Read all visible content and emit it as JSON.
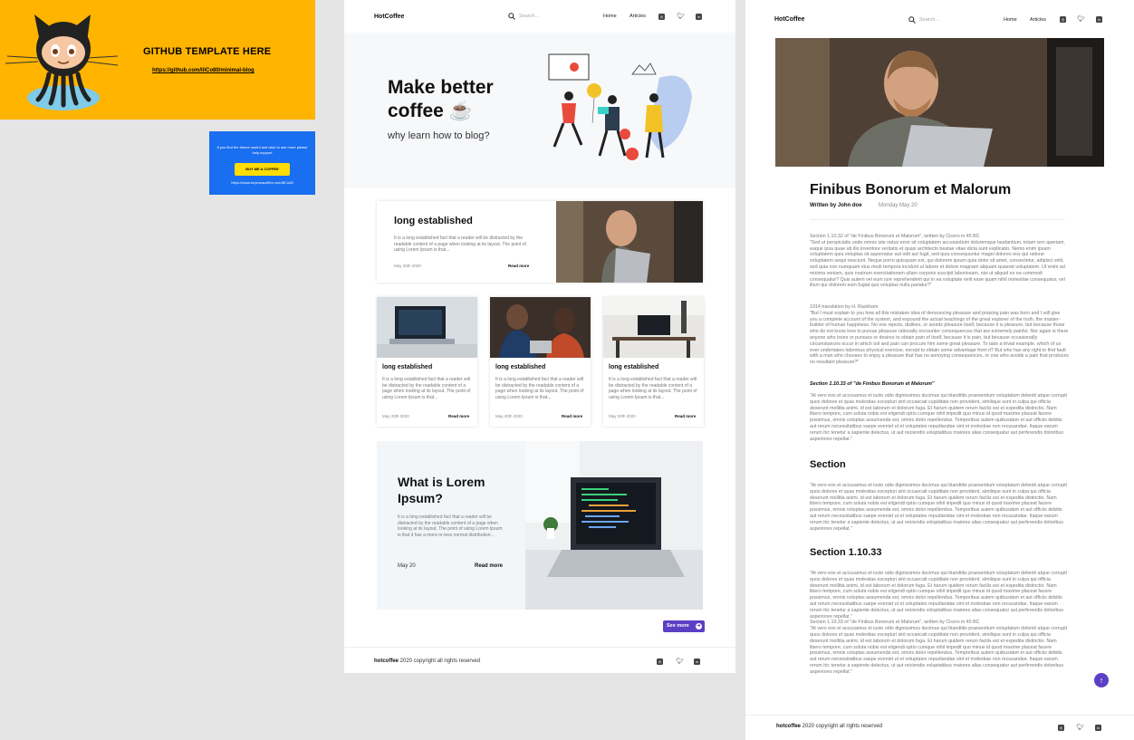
{
  "promo": {
    "github_title": "GITHUB TEMPLATE HERE",
    "github_link": "https://github.com/lilCo80/minimal-blog",
    "bmc_message": "If you find the theme useful and wish to see more please help support",
    "bmc_button": "BUY ME A COFFEE",
    "bmc_url": "https://www.buymeacoffee.com/lilCo80"
  },
  "nav": {
    "brand": "HotCoffee",
    "search_placeholder": "Search...",
    "home": "Home",
    "articles": "Articles"
  },
  "hero": {
    "title": "Make better coffee ☕",
    "subtitle": "why learn how to blog?"
  },
  "featured": {
    "title": "long established",
    "text": "It is a long established fact that a reader will be distracted by the readable content of a page when looking at its layout. The point of using Lorem Ipsum is that...",
    "date": "May 20th 2020",
    "more": "Read more"
  },
  "cards": [
    {
      "title": "long established",
      "text": "It is a long established fact that a reader will be distracted by the readable content of a page when looking at its layout. The point of using Lorem Ipsum is that...",
      "date": "May 20th 2020",
      "more": "Read more"
    },
    {
      "title": "long established",
      "text": "It is a long established fact that a reader will be distracted by the readable content of a page when looking at its layout. The point of using Lorem Ipsum is that...",
      "date": "May 20th 2020",
      "more": "Read more"
    },
    {
      "title": "long established",
      "text": "It is a long established fact that a reader will be distracted by the readable content of a page when looking at its layout. The point of using Lorem Ipsum is that...",
      "date": "May 20th 2020",
      "more": "Read more"
    }
  ],
  "big_card": {
    "title": "What is Lorem Ipsum?",
    "text": "It is a long established fact that a reader will be distracted by the readable content of a page when looking at its layout. The point of using Lorem Ipsum is that it has a more-or-less normal distribution...",
    "date": "May 20",
    "more": "Read more"
  },
  "see_more": "See more",
  "footer": {
    "brand": "hotcoffee",
    "text": " 2020 copyright all rights reserved"
  },
  "article": {
    "title": "Finibus Bonorum et Malorum",
    "author": "Written by John doe",
    "date": "Monday  May 20",
    "p1": "Section 1.10.32 of \"de Finibus Bonorum et Malorum\", written by Cicero in 45 BC\n\"Sed ut perspiciatis unde omnis iste natus error sit voluptatem accusantium doloremque laudantium, totam rem aperiam, eaque ipsa quae ab illo inventore veritatis et quasi architecto beatae vitae dicta sunt explicabo. Nemo enim ipsam voluptatem quia voluptas sit aspernatur aut odit aut fugit, sed quia consequuntur magni dolores eos qui ratione voluptatem sequi nesciunt. Neque porro quisquam est, qui dolorem ipsum quia dolor sit amet, consectetur, adipisci velit, sed quia non numquam eius modi tempora incidunt ut labore et dolore magnam aliquam quaerat voluptatem. Ut enim ad minima veniam, quis nostrum exercitationem ullam corporis suscipit laboriosam, nisi ut aliquid ex ea commodi consequatur? Quis autem vel eum iure reprehenderit qui in ea voluptate velit esse quam nihil molestiae consequatur, vel illum qui dolorem eum fugiat quo voluptas nulla pariatur?\"",
    "p2": "1914 translation by H. Rackham\n\"But I must explain to you how all this mistaken idea of denouncing pleasure and praising pain was born and I will give you a complete account of the system, and expound the actual teachings of the great explorer of the truth, the master-builder of human happiness. No one rejects, dislikes, or avoids pleasure itself, because it is pleasure, but because those who do not know how to pursue pleasure rationally encounter consequences that are extremely painful. Nor again is there anyone who loves or pursues or desires to obtain pain of itself, because it is pain, but because occasionally circumstances occur in which toil and pain can procure him some great pleasure. To take a trivial example, which of us ever undertakes laborious physical exercise, except to obtain some advantage from it? But who has any right to find fault with a man who chooses to enjoy a pleasure that has no annoying consequences, or one who avoids a pain that produces no resultant pleasure?\"",
    "h_italic": "Section 1.10.33 of \"de Finibus Bonorum et Malorum\"",
    "p3": "\"At vero eos et accusamus et iusto odio dignissimos ducimus qui blanditiis praesentium voluptatum deleniti atque corrupti quos dolores et quas molestias excepturi sint occaecati cupiditate non provident, similique sunt in culpa qui officia deserunt mollitia animi, id est laborum et dolorum fuga. Et harum quidem rerum facilis est et expedita distinctio. Nam libero tempore, cum soluta nobis est eligendi optio cumque nihil impedit quo minus id quod maxime placeat facere possimus, omnis voluptas assumenda est, omnis dolor repellendus. Temporibus autem quibusdam et aut officiis debitis aut rerum necessitatibus saepe eveniet ut et voluptates repudiandae sint et molestiae non recusandae. Itaque earum rerum hic tenetur a sapiente delectus, ut aut reiciendis voluptatibus maiores alias consequatur aut perferendis doloribus asperiores repellat.\"",
    "h_section": "Section",
    "p4": "\"At vero eos et accusamus et iusto odio dignissimos ducimus qui blanditiis praesentium voluptatum deleniti atque corrupti quos dolores et quas molestias excepturi sint occaecati cupiditate non provident, similique sunt in culpa qui officia deserunt mollitia animi, id est laborum et dolorum fuga. Et harum quidem rerum facilis est et expedita distinctio. Nam libero tempore, cum soluta nobis est eligendi optio cumque nihil impedit quo minus id quod maxime placeat facere possimus, omnis voluptas assumenda est, omnis dolor repellendus. Temporibus autem quibusdam et aut officiis debitis aut rerum necessitatibus saepe eveniet ut et voluptates repudiandae sint et molestiae non recusandae. Itaque earum rerum hic tenetur a sapiente delectus, ut aut reiciendis voluptatibus maiores alias consequatur aut perferendis doloribus asperiores repellat.\"",
    "h_section2": "Section 1.10.33",
    "p5": "\"At vero eos et accusamus et iusto odio dignissimos ducimus qui blanditiis praesentium voluptatum deleniti atque corrupti quos dolores et quas molestias excepturi sint occaecati cupiditate non provident, similique sunt in culpa qui officia deserunt mollitia animi, id est laborum et dolorum fuga. Et harum quidem rerum facilis est et expedita distinctio. Nam libero tempore, cum soluta nobis est eligendi optio cumque nihil impedit quo minus id quod maxime placeat facere possimus, omnis voluptas assumenda est, omnis dolor repellendus. Temporibus autem quibusdam et aut officiis debitis aut rerum necessitatibus saepe eveniet ut et voluptates repudiandae sint et molestiae non recusandae. Itaque earum rerum hic tenetur a sapiente delectus, ut aut reiciendis voluptatibus maiores alias consequatur aut perferendis doloribus asperiores repellat.\"\nSection 1.10.33 of \"de Finibus Bonorum et Malorum\", written by Cicero in 45 BC\n\"At vero eos et accusamus et iusto odio dignissimos ducimus qui blanditiis praesentium voluptatum deleniti atque corrupti quos dolores et quas molestias excepturi sint occaecati cupiditate non provident, similique sunt in culpa qui officia deserunt mollitia animi, id est laborum et dolorum fuga. Et harum quidem rerum facilis est et expedita distinctio. Nam libero tempore, cum soluta nobis est eligendi optio cumque nihil impedit quo minus id quod maxime placeat facere possimus, omnis voluptas assumenda est, omnis dolor repellendus. Temporibus autem quibusdam et aut officiis debitis aut rerum necessitatibus saepe eveniet ut et voluptates repudiandae sint et molestiae non recusandae. Itaque earum rerum hic tenetur a sapiente delectus, ut aut reiciendis voluptatibus maiores alias consequatur aut perferendis doloribus asperiores repellat.\""
  },
  "colors": {
    "promo_yellow": "#ffb400",
    "promo_blue": "#1a6ef0",
    "accent_purple": "#5b3fc4"
  },
  "icons": [
    "search-icon",
    "instagram-icon",
    "twitter-icon",
    "linkedin-icon",
    "arrow-right-icon",
    "arrow-up-icon",
    "octocat-logo"
  ]
}
